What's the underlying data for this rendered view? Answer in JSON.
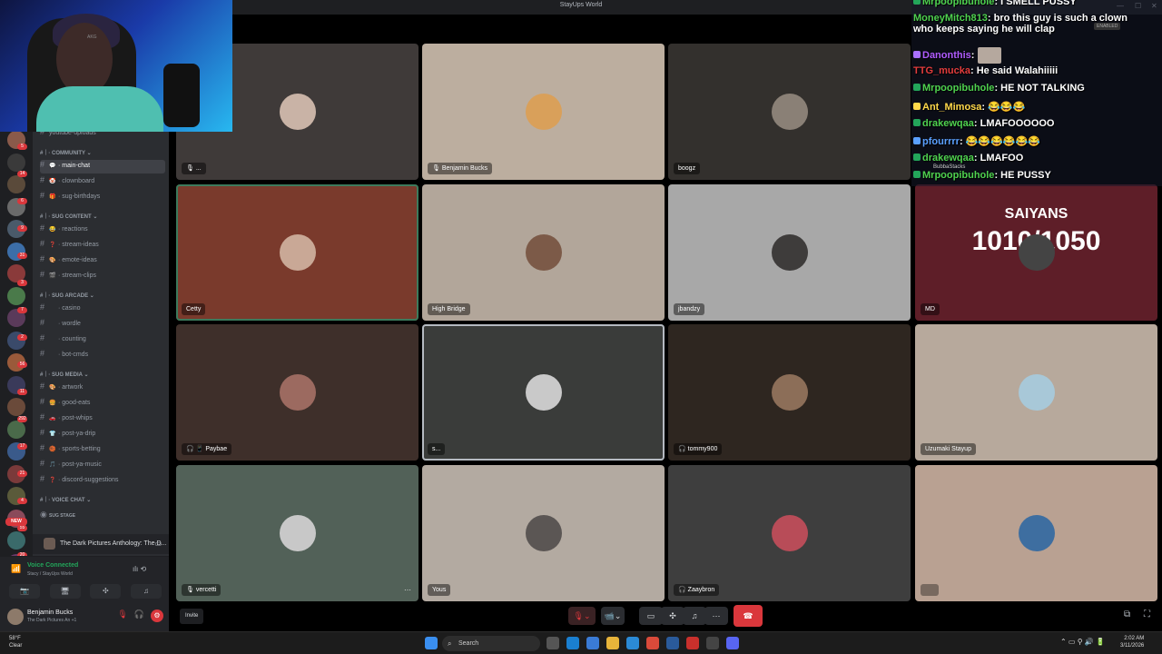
{
  "window": {
    "title": "StayUps World",
    "minimize": "—",
    "maximize": "☐",
    "close": "✕"
  },
  "webcam": {
    "mic_tag": "AKG"
  },
  "sidebar": {
    "partial_top": "youtube-uploads",
    "categories": [
      {
        "label": "COMMUNITY",
        "channels": [
          {
            "label": "main-chat",
            "emoji": "💬",
            "active": true
          },
          {
            "label": "clownboard",
            "emoji": "🤡"
          },
          {
            "label": "sug-birthdays",
            "emoji": "🎁"
          }
        ]
      },
      {
        "label": "SUG CONTENT",
        "channels": [
          {
            "label": "reactions",
            "emoji": "😂"
          },
          {
            "label": "stream-ideas",
            "emoji": "❓"
          },
          {
            "label": "emote-ideas",
            "emoji": "🎨"
          },
          {
            "label": "stream-clips",
            "emoji": "🎬"
          }
        ]
      },
      {
        "label": "SUG ARCADE",
        "channels": [
          {
            "label": "casino",
            "emoji": ""
          },
          {
            "label": "wordle",
            "emoji": ""
          },
          {
            "label": "counting",
            "emoji": ""
          },
          {
            "label": "bot-cmds",
            "emoji": ""
          }
        ]
      },
      {
        "label": "SUG MEDIA",
        "channels": [
          {
            "label": "artwork",
            "emoji": "🎨"
          },
          {
            "label": "good-eats",
            "emoji": "🍔"
          },
          {
            "label": "post-whips",
            "emoji": "🚗"
          },
          {
            "label": "post-ya-drip",
            "emoji": "👕"
          },
          {
            "label": "sports-betting",
            "emoji": "🏀"
          },
          {
            "label": "post-ya-music",
            "emoji": "🎵"
          },
          {
            "label": "discord-suggestions",
            "emoji": "❓"
          }
        ]
      },
      {
        "label": "VOICE CHAT",
        "channels": []
      }
    ],
    "stage": "SUG STAGE",
    "new_badge": "NEW"
  },
  "server_badges": [
    "5",
    "14",
    "6",
    "9",
    "31",
    "3",
    "7",
    "2",
    "56",
    "11",
    "292",
    "17",
    "21",
    "4",
    "55",
    "20"
  ],
  "activity": {
    "label": "The Dark Pictures Anthology: The D..."
  },
  "voice": {
    "status": "Voice Connected",
    "channel": "Stacy / StayUps World"
  },
  "user": {
    "name": "Benjamin Bucks",
    "status": "The Dark Pictures An +1"
  },
  "chat": {
    "messages": [
      {
        "user": "Mrpoopibuhole",
        "color": "#4fd24f",
        "text": "I SMELL PUSSY",
        "badge": "#23a55a"
      },
      {
        "user": "MoneyMitch813",
        "color": "#4fd24f",
        "text": "bro this guy is such a clown",
        "cont": "who keeps saying he will clap",
        "badge": ""
      },
      {
        "user": "Danonthis",
        "color": "#b05cff",
        "text": "",
        "badge": "#a970ff",
        "emote": true
      },
      {
        "user": "TTG_mucka",
        "color": "#e33c3c",
        "text": "He said Walahiiiii",
        "badge": ""
      },
      {
        "user": "Mrpoopibuhole",
        "color": "#4fd24f",
        "text": "HE NOT TALKING",
        "badge": "#23a55a"
      },
      {
        "user": "Ant_Mimosa",
        "color": "#ffd84a",
        "text": "😂😂😂",
        "badge": "#ffd84a"
      },
      {
        "user": "drakewqaa",
        "color": "#4fd24f",
        "text": "LMAFOOOOOO",
        "badge": "#23a55a"
      },
      {
        "user": "pfourrrr",
        "color": "#5aa0ff",
        "text": "😂😂😂😂😂😂",
        "badge": "#5aa0ff"
      },
      {
        "user": "drakewqaa",
        "color": "#4fd24f",
        "text": "LMAFOO",
        "badge": "#23a55a"
      },
      {
        "user": "Mrpoopibuhole",
        "color": "#4fd24f",
        "text": "HE PUSSY",
        "badge": "#23a55a"
      }
    ],
    "overlay_tag": "BubbaStacks",
    "enabled_tag": "ENABLED"
  },
  "tiles": [
    {
      "name": "...",
      "bg": "#3f3a39",
      "avatar": "#c9b3a6",
      "icons": "🎙"
    },
    {
      "name": "Benjamin Bucks",
      "bg": "#bcae9f",
      "avatar": "#d9a05a",
      "icons": "🎙"
    },
    {
      "name": "boogz",
      "bg": "#33302d",
      "avatar": "#8a8076",
      "icons": ""
    },
    {
      "name": "",
      "bg": "#33302d",
      "avatar": "",
      "icons": ""
    },
    {
      "name": "Cetty",
      "bg": "#7a3a2c",
      "avatar": "#c9a896",
      "icons": ""
    },
    {
      "name": "High Bridge",
      "bg": "#b2a69a",
      "avatar": "#7c5a48",
      "icons": ""
    },
    {
      "name": "jbandzy",
      "bg": "#a8a8a8",
      "avatar": "#3e3c3b",
      "icons": ""
    },
    {
      "name": "MD",
      "bg": "#5e1e28",
      "avatar": "#444",
      "icons": ""
    },
    {
      "name": "Paybae",
      "bg": "#3e2f2a",
      "avatar": "#9c6a60",
      "icons": "🎧 📱"
    },
    {
      "name": "s...",
      "bg": "#3a3c3a",
      "avatar": "#c9c9c9",
      "icons": ""
    },
    {
      "name": "tommy900",
      "bg": "#2e2620",
      "avatar": "#8c6e58",
      "icons": "🎧"
    },
    {
      "name": "Uzumaki Stayup",
      "bg": "#b7a99c",
      "avatar": "#a8c8d8",
      "icons": ""
    },
    {
      "name": "vercetti",
      "bg": "#526158",
      "avatar": "#c8c8c8",
      "icons": "🎙"
    },
    {
      "name": "Yous",
      "bg": "#b3aaa1",
      "avatar": "#5b5654",
      "icons": ""
    },
    {
      "name": "Zaaybron",
      "bg": "#3e3e3e",
      "avatar": "#b84c58",
      "icons": "🎧"
    },
    {
      "name": "",
      "bg": "#b9a192",
      "avatar": "#3e6ea0",
      "icons": ""
    }
  ],
  "saiyans": {
    "title": "SAIYANS",
    "count": "1010/1050"
  },
  "controls": {
    "invite": "Invite"
  },
  "taskbar": {
    "temp": "58°F",
    "cond": "Clear",
    "search": "Search",
    "time": "2:02 AM",
    "date": "3/11/2026"
  }
}
